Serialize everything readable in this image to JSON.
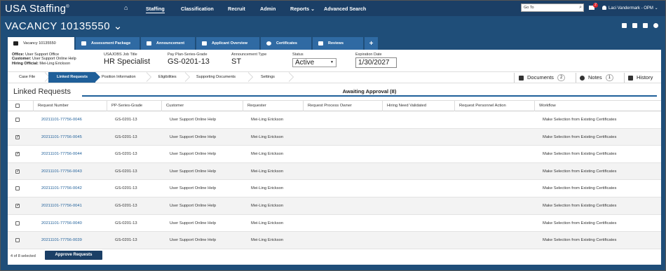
{
  "app": {
    "logo_text": "USA Staffing",
    "logo_mark": "®"
  },
  "nav": {
    "items": [
      "Staffing",
      "Classification",
      "Recruit",
      "Admin",
      "Reports ⌄",
      "Advanced Search"
    ],
    "active": "Staffing",
    "goto_placeholder": "Go To",
    "mail_badge": "2",
    "user_name": "Laci Vandermark - OPM ⌄"
  },
  "vacancy": {
    "title": "VACANCY 10135550 ⌄"
  },
  "tabs": [
    "Vacancy 10135550",
    "Assessment Package",
    "Announcement",
    "Applicant Overview",
    "Certificates",
    "Reviews",
    "+"
  ],
  "info": {
    "office_label": "Office:",
    "office_value": "User Support Office",
    "customer_label": "Customer:",
    "customer_value": "User Support Online Help",
    "hiring_label": "Hiring Official:",
    "hiring_value": "Mei-Ling Erickson",
    "job_title_label": "USAJOBS Job Title",
    "job_title_value": "HR Specialist",
    "pay_plan_label": "Pay Plan-Series-Grade",
    "pay_plan_value": "GS-0201-13",
    "ann_type_label": "Announcement Type",
    "ann_type_value": "ST",
    "status_label": "Status",
    "status_value": "Active",
    "exp_label": "Expiration Date",
    "exp_value": "1/30/2027"
  },
  "crumbs": [
    "Case File",
    "Linked Requests",
    "Position Information",
    "Eligibilities",
    "Supporting Documents",
    "Settings"
  ],
  "right_buttons": {
    "documents": "Documents",
    "documents_count": "2",
    "notes": "Notes",
    "notes_count": "1",
    "history": "History"
  },
  "linked": {
    "title": "Linked Requests",
    "tab": "Awaiting Approval (8)"
  },
  "table": {
    "headers": [
      "Request Number",
      "PP-Series-Grade",
      "Customer",
      "Requester",
      "Request Process Owner",
      "Hiring Need Validated",
      "Request Personnel Action",
      "Workflow"
    ],
    "rows": [
      {
        "checked": false,
        "number": "20211101-77756-0046",
        "ppsg": "GS-0201-13",
        "customer": "User Support Online Help",
        "requester": "Mei-Ling Erickson",
        "workflow": "Make Selection from Existing Certificates"
      },
      {
        "checked": true,
        "number": "20211101-77756-0045",
        "ppsg": "GS-0201-13",
        "customer": "User Support Online Help",
        "requester": "Mei-Ling Erickson",
        "workflow": "Make Selection from Existing Certificates"
      },
      {
        "checked": true,
        "number": "20211101-77756-0044",
        "ppsg": "GS-0201-13",
        "customer": "User Support Online Help",
        "requester": "Mei-Ling Erickson",
        "workflow": "Make Selection from Existing Certificates"
      },
      {
        "checked": true,
        "number": "20211101-77756-0043",
        "ppsg": "GS-0201-13",
        "customer": "User Support Online Help",
        "requester": "Mei-Ling Erickson",
        "workflow": "Make Selection from Existing Certificates"
      },
      {
        "checked": false,
        "number": "20211101-77756-0042",
        "ppsg": "GS-0201-13",
        "customer": "User Support Online Help",
        "requester": "Mei-Ling Erickson",
        "workflow": "Make Selection from Existing Certificates"
      },
      {
        "checked": true,
        "number": "20211101-77756-0041",
        "ppsg": "GS-0201-13",
        "customer": "User Support Online Help",
        "requester": "Mei-Ling Erickson",
        "workflow": "Make Selection from Existing Certificates"
      },
      {
        "checked": false,
        "number": "20211101-77756-0040",
        "ppsg": "GS-0201-13",
        "customer": "User Support Online Help",
        "requester": "Mei-Ling Erickson",
        "workflow": "Make Selection from Existing Certificates"
      },
      {
        "checked": false,
        "number": "20211101-77756-0039",
        "ppsg": "GS-0201-13",
        "customer": "User Support Online Help",
        "requester": "Mei-Ling Erickson",
        "workflow": "Make Selection from Existing Certificates"
      }
    ]
  },
  "footer": {
    "selected_text": "4 of 8 selected",
    "approve_label": "Approve Requests"
  },
  "colors": {
    "brand_navy": "#1b3f66",
    "accent_blue": "#1f5f99",
    "link_blue": "#1f5f99"
  }
}
